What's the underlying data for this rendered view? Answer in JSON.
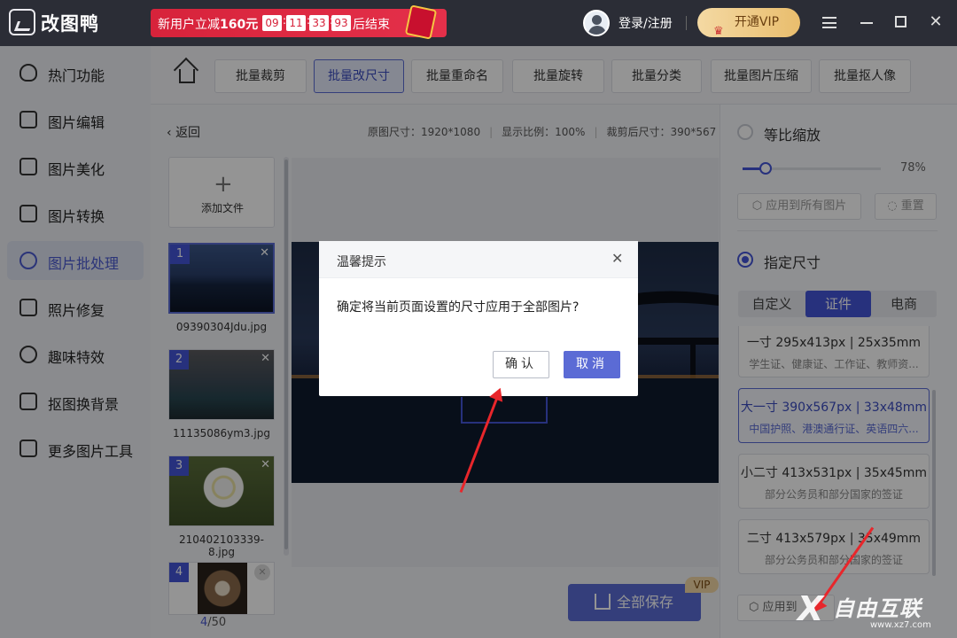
{
  "titlebar": {
    "app_name": "改图鸭",
    "promo_text": "新用户立减",
    "promo_amount": "160元",
    "countdown": [
      "09",
      "11",
      "33",
      "93"
    ],
    "promo_end": "后结束",
    "login": "登录/注册",
    "vip_label": "开通VIP"
  },
  "sidebar": {
    "items": [
      {
        "label": "热门功能"
      },
      {
        "label": "图片编辑"
      },
      {
        "label": "图片美化"
      },
      {
        "label": "图片转换"
      },
      {
        "label": "图片批处理"
      },
      {
        "label": "照片修复"
      },
      {
        "label": "趣味特效"
      },
      {
        "label": "抠图换背景"
      },
      {
        "label": "更多图片工具"
      }
    ]
  },
  "toolbar": {
    "tabs": [
      {
        "label": "批量裁剪"
      },
      {
        "label": "批量改尺寸"
      },
      {
        "label": "批量重命名"
      },
      {
        "label": "批量旋转"
      },
      {
        "label": "批量分类"
      },
      {
        "label": "批量图片压缩"
      },
      {
        "label": "批量抠人像"
      }
    ]
  },
  "content": {
    "back": "返回",
    "original_size": "原图尺寸：1920*1080",
    "display_ratio": "显示比例：100%",
    "cropped_size": "裁剪后尺寸：390*567",
    "add_file": "添加文件",
    "files": [
      {
        "num": "1",
        "name": "09390304Jdu.jpg"
      },
      {
        "num": "2",
        "name": "11135086ym3.jpg"
      },
      {
        "num": "3",
        "name": "210402103339-8.jpg"
      },
      {
        "num": "4",
        "name": ""
      }
    ],
    "pager_current": "4",
    "pager_total": "/50",
    "save_all": "全部保存",
    "vip_tag": "VIP"
  },
  "right_panel": {
    "proportional": "等比缩放",
    "slider_value": "78%",
    "slider_fraction": 0.17,
    "apply_all": "应用到所有图片",
    "reset": "重置",
    "specified": "指定尺寸",
    "segments": [
      "自定义",
      "证件",
      "电商"
    ],
    "sizes": [
      {
        "title": "一寸 295x413px | 25x35mm",
        "sub": "学生证、健康证、工作证、教师资..."
      },
      {
        "title": "大一寸 390x567px | 33x48mm",
        "sub": "中国护照、港澳通行证、英语四六..."
      },
      {
        "title": "小二寸 413x531px | 35x45mm",
        "sub": "部分公务员和部分国家的签证"
      },
      {
        "title": "二寸 413x579px | 35x49mm",
        "sub": "部分公务员和部分国家的签证"
      }
    ],
    "apply_bottom": "应用到"
  },
  "dialog": {
    "title": "温馨提示",
    "message": "确定将当前页面设置的尺寸应用于全部图片?",
    "confirm": "确认",
    "cancel": "取消"
  },
  "watermark": {
    "text": "自由互联",
    "url": "www.xz7.com"
  },
  "colors": {
    "accent": "#4455d8",
    "titlebar": "#2b2d36",
    "promo": "#d7233b",
    "arrow": "#e8262b"
  }
}
